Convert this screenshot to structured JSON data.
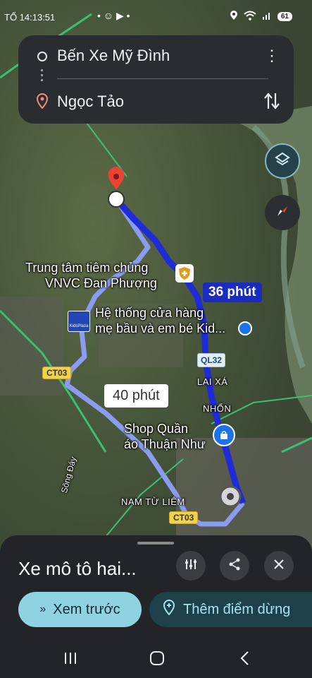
{
  "status_bar": {
    "time": "TỔ 14:13:51",
    "dots": "• ☺ ▶ •",
    "battery": "61"
  },
  "route": {
    "origin": "Bến Xe Mỹ Đình",
    "destination": "Ngọc Tảo"
  },
  "map": {
    "poi_vnvc_line1": "Trung tâm tiêm chủng",
    "poi_vnvc_line2": "VNVC Đan Phượng",
    "poi_kids_line1": "Hệ thống cửa hàng",
    "poi_kids_line2": "mẹ bầu và em bé Kid...",
    "poi_shop_line1": "Shop Quần",
    "poi_shop_line2": "áo Thuận Như",
    "kids_logo": "KidsPlaza",
    "area_lai_xa": "LAI XÁ",
    "area_nhon": "NHỔN",
    "area_nam_tu_liem": "NAM TỪ LIÊM",
    "river_song_day": "Sông Đáy",
    "road_ct03_a": "CT03",
    "road_ct03_b": "CT03",
    "road_ql32": "QL32",
    "time_main": "36 phút",
    "time_alt": "40 phút"
  },
  "colors": {
    "route_main": "#1f2bd6",
    "route_alt": "#8b9bf0",
    "accent": "#8fd3e2",
    "pin": "#ea4335"
  },
  "sheet": {
    "mode_title": "Xe mô tô hai...",
    "preview_label": "Xem trước",
    "add_stop_label": "Thêm điểm dừng"
  }
}
